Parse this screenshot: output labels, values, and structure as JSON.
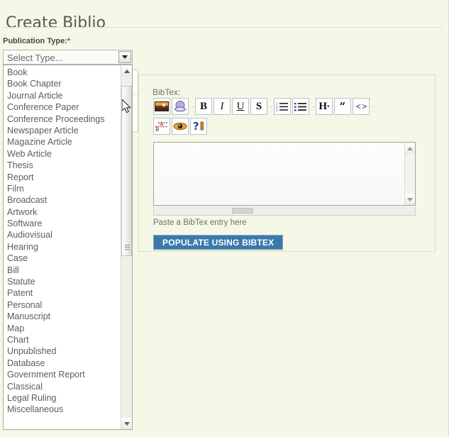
{
  "page": {
    "title": "Create Biblio",
    "background_color": "#f5f8e6"
  },
  "publication_type": {
    "label": "Publication Type:",
    "required_marker": "*",
    "selected_value": "Select Type...",
    "dropdown_open": true,
    "options": [
      "Book",
      "Book Chapter",
      "Journal Article",
      "Conference Paper",
      "Conference Proceedings",
      "Newspaper Article",
      "Magazine Article",
      "Web Article",
      "Thesis",
      "Report",
      "Film",
      "Broadcast",
      "Artwork",
      "Software",
      "Audiovisual",
      "Hearing",
      "Case",
      "Bill",
      "Statute",
      "Patent",
      "Personal",
      "Manuscript",
      "Map",
      "Chart",
      "Unpublished",
      "Database",
      "Government Report",
      "Classical",
      "Legal Ruling",
      "Miscellaneous"
    ]
  },
  "bibtex": {
    "legend": "BibTex:",
    "textarea_value": "",
    "hint": "Paste a BibTex entry here",
    "populate_button": "POPULATE USING BIBTEX",
    "populate_button_color": "#3c79ab",
    "toolbar": {
      "row1": [
        {
          "name": "insert-image-icon",
          "glyph": ""
        },
        {
          "name": "insert-media-icon",
          "glyph": ""
        },
        {
          "name": "separator-1",
          "glyph": "·"
        },
        {
          "name": "bold-icon",
          "glyph": "B"
        },
        {
          "name": "italic-icon",
          "glyph": "I"
        },
        {
          "name": "underline-icon",
          "glyph": "U"
        },
        {
          "name": "strikethrough-icon",
          "glyph": "S"
        },
        {
          "name": "separator-2",
          "glyph": "·"
        },
        {
          "name": "ordered-list-icon",
          "glyph": ""
        },
        {
          "name": "unordered-list-icon",
          "glyph": ""
        },
        {
          "name": "separator-3",
          "glyph": "·"
        },
        {
          "name": "heading-icon",
          "glyph": "H"
        },
        {
          "name": "blockquote-icon",
          "glyph": "“"
        },
        {
          "name": "source-code-icon",
          "glyph": "<>"
        },
        {
          "name": "separator-4",
          "glyph": "·"
        }
      ],
      "row2": [
        {
          "name": "find-replace-icon",
          "glyph": ""
        },
        {
          "name": "preview-icon",
          "glyph": ""
        },
        {
          "name": "help-icon",
          "glyph": "?"
        }
      ]
    }
  }
}
